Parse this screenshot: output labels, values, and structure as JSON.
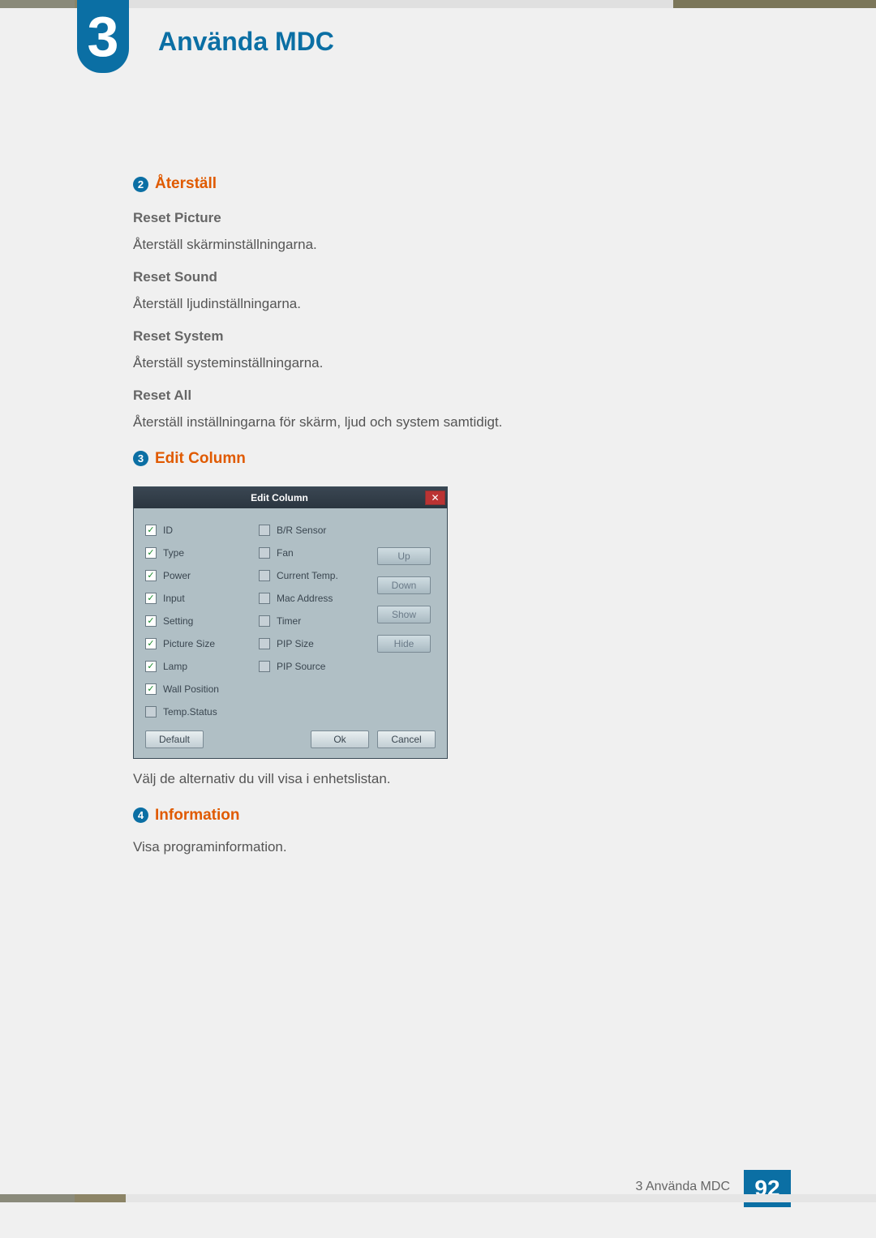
{
  "chapter": {
    "num": "3",
    "title": "Använda MDC"
  },
  "footer": {
    "label": "3 Använda MDC",
    "page": "92"
  },
  "s2": {
    "num": "2",
    "title": "Återställ",
    "items": [
      {
        "h": "Reset Picture",
        "t": "Återställ skärminställningarna."
      },
      {
        "h": "Reset Sound",
        "t": "Återställ ljudinställningarna."
      },
      {
        "h": "Reset System",
        "t": "Återställ systeminställningarna."
      },
      {
        "h": "Reset All",
        "t": "Återställ inställningarna för skärm, ljud och system samtidigt."
      }
    ]
  },
  "s3": {
    "num": "3",
    "title": "Edit Column",
    "after_text": "Välj de alternativ du vill visa i enhetslistan."
  },
  "s4": {
    "num": "4",
    "title": "Information",
    "text": "Visa programinformation."
  },
  "dialog": {
    "title": "Edit Column",
    "close": "✕",
    "col1": [
      {
        "label": "ID",
        "checked": true
      },
      {
        "label": "Type",
        "checked": true
      },
      {
        "label": "Power",
        "checked": true
      },
      {
        "label": "Input",
        "checked": true
      },
      {
        "label": "Setting",
        "checked": true
      },
      {
        "label": "Picture Size",
        "checked": true
      },
      {
        "label": "Lamp",
        "checked": true
      },
      {
        "label": "Wall Position",
        "checked": true
      },
      {
        "label": "Temp.Status",
        "checked": false
      }
    ],
    "col2": [
      {
        "label": "B/R Sensor",
        "checked": false
      },
      {
        "label": "Fan",
        "checked": false
      },
      {
        "label": "Current Temp.",
        "checked": false
      },
      {
        "label": "Mac Address",
        "checked": false
      },
      {
        "label": "Timer",
        "checked": false
      },
      {
        "label": "PIP Size",
        "checked": false
      },
      {
        "label": "PIP Source",
        "checked": false
      }
    ],
    "side_buttons": [
      "Up",
      "Down",
      "Show",
      "Hide"
    ],
    "footer": {
      "left": "Default",
      "ok": "Ok",
      "cancel": "Cancel"
    }
  }
}
